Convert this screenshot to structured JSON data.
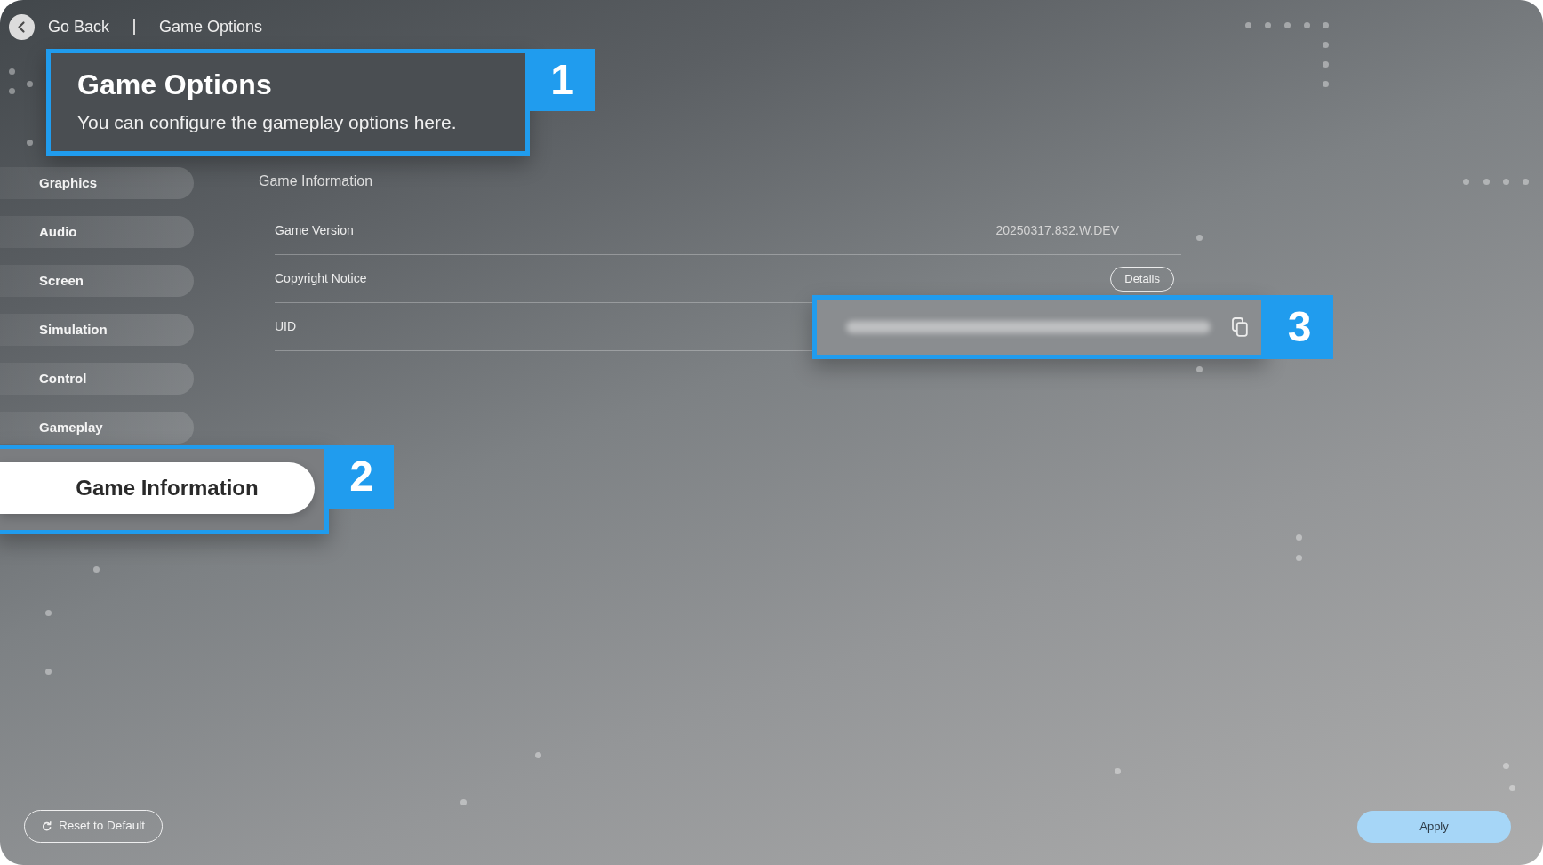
{
  "header": {
    "back_label": "Go Back",
    "breadcrumb": "Game Options"
  },
  "title_panel": {
    "title": "Game Options",
    "subtitle": "You can configure the gameplay options here.",
    "callout": "1"
  },
  "sidebar": {
    "items": [
      {
        "label": "Graphics",
        "selected": false
      },
      {
        "label": "Audio",
        "selected": false
      },
      {
        "label": "Screen",
        "selected": false
      },
      {
        "label": "Simulation",
        "selected": false
      },
      {
        "label": "Control",
        "selected": false
      },
      {
        "label": "Gameplay",
        "selected": false
      },
      {
        "label": "Game Information",
        "selected": true,
        "callout": "2"
      }
    ]
  },
  "section": {
    "heading": "Game Information",
    "rows": [
      {
        "kind": "value",
        "label": "Game Version",
        "value": "20250317.832.W.DEV"
      },
      {
        "kind": "button",
        "label": "Copyright Notice",
        "button": "Details"
      },
      {
        "kind": "masked",
        "label": "UID",
        "callout": "3"
      }
    ]
  },
  "footer": {
    "reset_label": "Reset to Default",
    "apply_label": "Apply"
  }
}
